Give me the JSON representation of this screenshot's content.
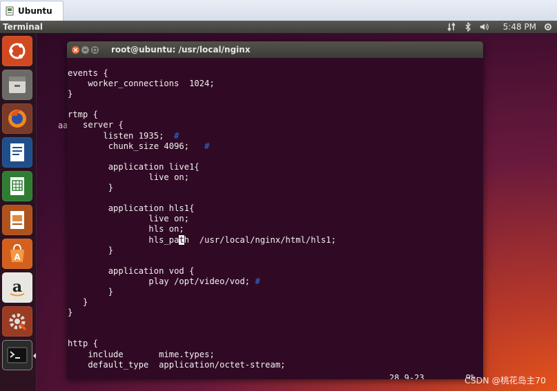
{
  "host": {
    "tab_label": "Ubuntu"
  },
  "panel": {
    "app_title": "Terminal",
    "clock": "5:48 PM"
  },
  "desktop": {
    "stray_text": "aa"
  },
  "terminal": {
    "title": "root@ubuntu: /usr/local/nginx",
    "lines": [
      {
        "text": "events {"
      },
      {
        "text": "    worker_connections  1024;"
      },
      {
        "text": "}"
      },
      {
        "text": ""
      },
      {
        "text": "rtmp {"
      },
      {
        "text": "   server {"
      },
      {
        "text": "       listen 1935;  ",
        "comment": "#"
      },
      {
        "text": "        chunk_size 4096;   ",
        "comment": "#"
      },
      {
        "text": ""
      },
      {
        "text": "        application live1{"
      },
      {
        "text": "                live on;"
      },
      {
        "text": "        }"
      },
      {
        "text": ""
      },
      {
        "text": "        application hls1{"
      },
      {
        "text": "                live on;"
      },
      {
        "text": "                hls on;"
      },
      {
        "text": "                hls_pa",
        "cursor": "t",
        "after": "h  /usr/local/nginx/html/hls1;"
      },
      {
        "text": "        }"
      },
      {
        "text": ""
      },
      {
        "text": "        application vod {"
      },
      {
        "text": "                play /opt/video/vod; ",
        "comment": "#"
      },
      {
        "text": "        }"
      },
      {
        "text": "   }"
      },
      {
        "text": "}"
      },
      {
        "text": ""
      },
      {
        "text": ""
      },
      {
        "text": "http {"
      },
      {
        "text": "    include       mime.types;"
      },
      {
        "text": "    default_type  application/octet-stream;"
      }
    ],
    "status_position": "28,9-23",
    "status_percent": "9%"
  },
  "watermark": "CSDN @桃花岛主70",
  "colors": {
    "terminal_bg": "#300a24",
    "comment": "#3b6fd4",
    "close_button": "#ef6b3d"
  },
  "launcher_icons": [
    "ubuntu-dash-icon",
    "files-icon",
    "firefox-icon",
    "writer-icon",
    "calc-icon",
    "impress-icon",
    "software-center-icon",
    "amazon-icon",
    "settings-icon",
    "terminal-icon"
  ]
}
